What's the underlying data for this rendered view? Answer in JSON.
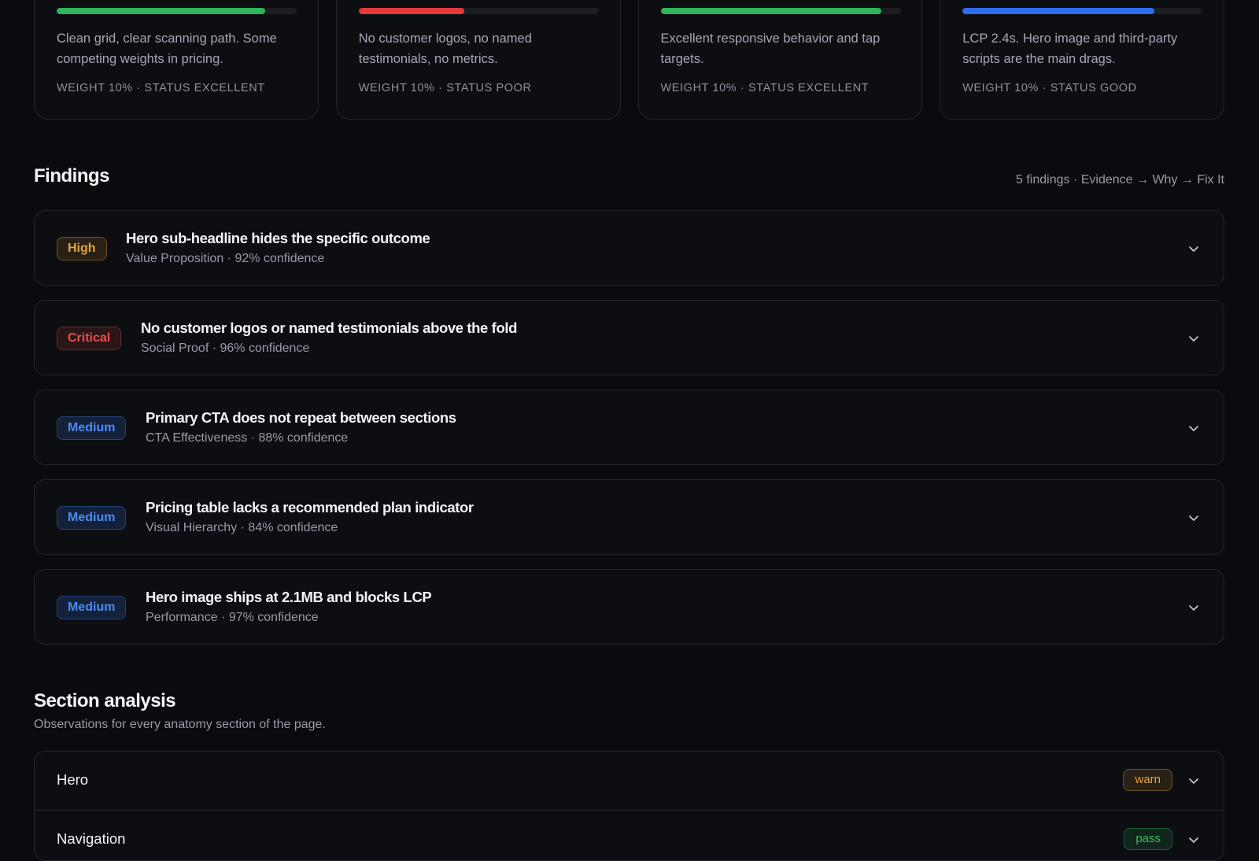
{
  "cards": [
    {
      "progress_percent": 87,
      "color": "#2fb55a",
      "description": "Clean grid, clear scanning path. Some competing weights in pricing.",
      "meta": "WEIGHT 10% · STATUS EXCELLENT"
    },
    {
      "progress_percent": 44,
      "color": "#e5383b",
      "description": "No customer logos, no named testimonials, no metrics.",
      "meta": "WEIGHT 10% · STATUS POOR"
    },
    {
      "progress_percent": 92,
      "color": "#2fb55a",
      "description": "Excellent responsive behavior and tap targets.",
      "meta": "WEIGHT 10% · STATUS EXCELLENT"
    },
    {
      "progress_percent": 80,
      "color": "#2f6df0",
      "description": "LCP 2.4s. Hero image and third-party scripts are the main drags.",
      "meta": "WEIGHT 10% · STATUS GOOD"
    }
  ],
  "findings": {
    "title": "Findings",
    "summary": "5 findings · Evidence → Why → Fix It",
    "items": [
      {
        "severity": "High",
        "title": "Hero sub-headline hides the specific outcome",
        "subtitle": "Value Proposition · 92% confidence"
      },
      {
        "severity": "Critical",
        "title": "No customer logos or named testimonials above the fold",
        "subtitle": "Social Proof · 96% confidence"
      },
      {
        "severity": "Medium",
        "title": "Primary CTA does not repeat between sections",
        "subtitle": "CTA Effectiveness · 88% confidence"
      },
      {
        "severity": "Medium",
        "title": "Pricing table lacks a recommended plan indicator",
        "subtitle": "Visual Hierarchy · 84% confidence"
      },
      {
        "severity": "Medium",
        "title": "Hero image ships at 2.1MB and blocks LCP",
        "subtitle": "Performance · 97% confidence"
      }
    ]
  },
  "section_analysis": {
    "title": "Section analysis",
    "subtitle": "Observations for every anatomy section of the page.",
    "rows": [
      {
        "label": "Hero",
        "status": "warn"
      },
      {
        "label": "Navigation",
        "status": "pass"
      }
    ]
  },
  "icons": {
    "expand": "chevron-down-icon"
  }
}
